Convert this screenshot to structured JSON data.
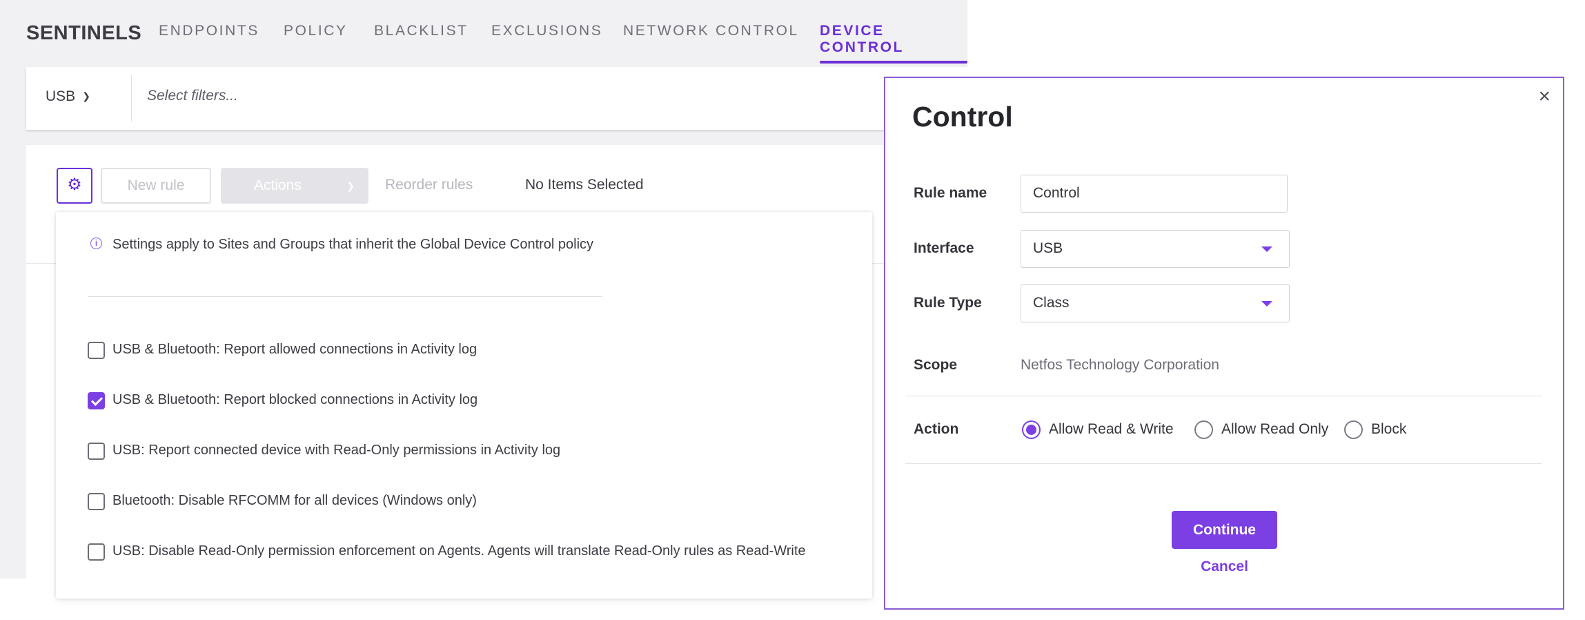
{
  "nav": {
    "brand": "SENTINELS",
    "tabs": [
      {
        "label": "ENDPOINTS"
      },
      {
        "label": "POLICY"
      },
      {
        "label": "BLACKLIST"
      },
      {
        "label": "EXCLUSIONS"
      },
      {
        "label": "NETWORK CONTROL"
      },
      {
        "label": "DEVICE CONTROL",
        "active": true
      }
    ]
  },
  "filter": {
    "type": "USB",
    "placeholder": "Select filters..."
  },
  "toolbar": {
    "new_rule": "New rule",
    "actions": "Actions",
    "reorder": "Reorder rules",
    "selection_status": "No Items Selected"
  },
  "settings": {
    "info": "Settings apply to Sites and Groups that inherit the Global Device Control policy",
    "options": [
      {
        "label": "USB & Bluetooth: Report allowed connections in Activity log",
        "checked": false
      },
      {
        "label": "USB & Bluetooth: Report blocked connections in Activity log",
        "checked": true
      },
      {
        "label": "USB: Report connected device with Read-Only permissions in Activity log",
        "checked": false
      },
      {
        "label": "Bluetooth: Disable RFCOMM for all devices (Windows only)",
        "checked": false
      },
      {
        "label": "USB: Disable Read-Only permission enforcement on Agents. Agents will translate Read-Only rules as Read-Write",
        "checked": false
      }
    ]
  },
  "modal": {
    "title": "Control",
    "close": "×",
    "fields": {
      "rule_name_label": "Rule name",
      "rule_name_value": "Control",
      "interface_label": "Interface",
      "interface_value": "USB",
      "rule_type_label": "Rule Type",
      "rule_type_value": "Class",
      "scope_label": "Scope",
      "scope_value": "Netfos Technology Corporation",
      "action_label": "Action"
    },
    "actions": [
      {
        "label": "Allow Read & Write",
        "selected": true
      },
      {
        "label": "Allow Read Only",
        "selected": false
      },
      {
        "label": "Block",
        "selected": false
      }
    ],
    "continue": "Continue",
    "cancel": "Cancel"
  },
  "colors": {
    "accent": "#7b3fe4",
    "accent_dark": "#6b2fd6",
    "background": "#f1f0f3"
  }
}
